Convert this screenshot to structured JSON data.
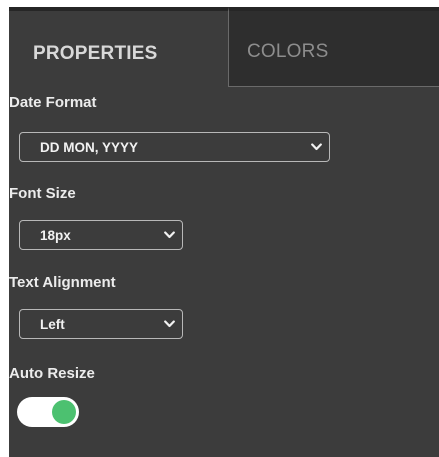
{
  "tabs": [
    {
      "label": "PROPERTIES",
      "active": true
    },
    {
      "label": "COLORS",
      "active": false
    }
  ],
  "fields": {
    "date_format": {
      "label": "Date Format",
      "value": "DD MON, YYYY"
    },
    "font_size": {
      "label": "Font Size",
      "value": "18px"
    },
    "text_alignment": {
      "label": "Text Alignment",
      "value": "Left"
    },
    "auto_resize": {
      "label": "Auto Resize",
      "enabled": true
    }
  },
  "colors": {
    "panel_bg": "#3c3c3c",
    "toggle_on": "#4cc170"
  },
  "icons": {
    "dropdown": "chevron-down-icon"
  }
}
